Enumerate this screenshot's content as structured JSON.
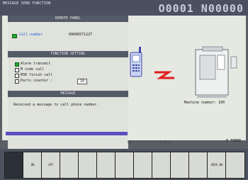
{
  "topbar": {
    "title": "MESSAGE SEND FUNCTION",
    "ref": "O0001 N00000"
  },
  "section_top": {
    "header": "REMOTE PANEL",
    "call_button_label": "Call number",
    "phone_number": "09096571227"
  },
  "function_section": {
    "header": "FUNCTION SETTING",
    "options": [
      {
        "label": "Alarm transmit",
        "checked": true
      },
      {
        "label": "M code call",
        "checked": false
      },
      {
        "label": "M30 finish call",
        "checked": false
      },
      {
        "label": "Parts counter :",
        "checked": false,
        "value": "10"
      }
    ]
  },
  "message_section": {
    "header": "MESSAGE",
    "text": "Received a message to call phone number."
  },
  "diagram": {
    "machine_label": "Machine number: 100"
  },
  "status": {
    "line": "EDIT **** *** ***    10:25:40",
    "pos": "0  T0000"
  },
  "softkeys": [
    {
      "label": "",
      "dark": true
    },
    {
      "label": "ON",
      "dark": false
    },
    {
      "label": "OFF",
      "dark": false
    },
    {
      "label": "",
      "dark": false
    },
    {
      "label": "",
      "dark": false
    },
    {
      "label": "",
      "dark": false
    },
    {
      "label": "",
      "dark": false
    },
    {
      "label": "",
      "dark": false
    },
    {
      "label": "",
      "dark": false
    },
    {
      "label": "",
      "dark": false
    },
    {
      "label": "",
      "dark": false
    },
    {
      "label": "VERS.NO",
      "dark": false
    },
    {
      "label": "",
      "dark": false
    }
  ]
}
